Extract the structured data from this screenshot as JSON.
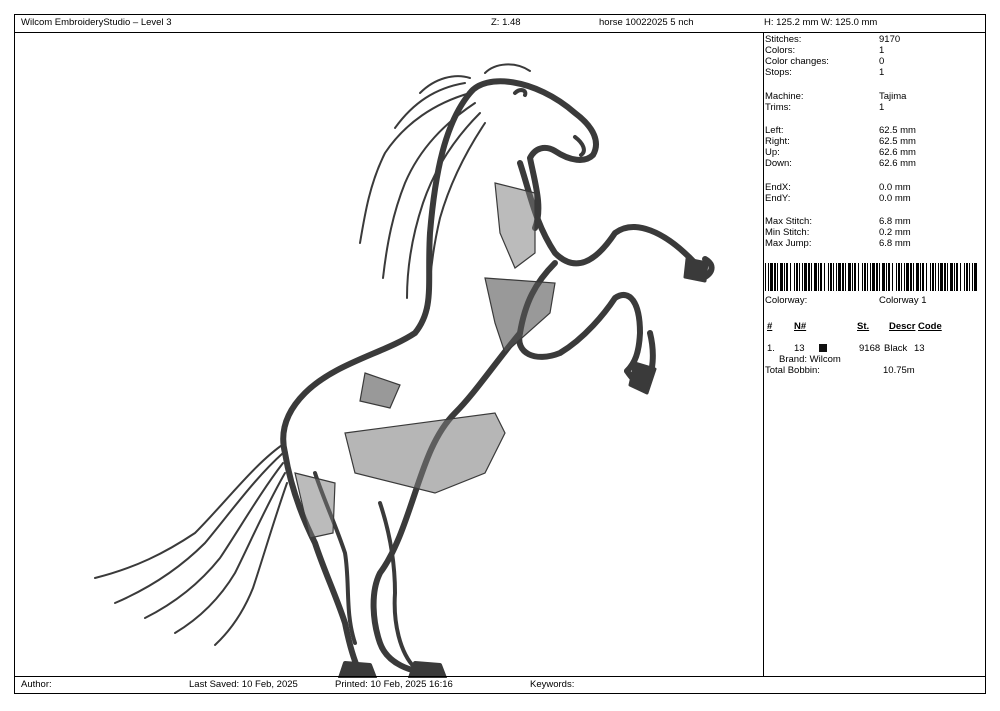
{
  "header": {
    "app_title": "Wilcom EmbroideryStudio – Level 3",
    "zoom": "Z: 1.48",
    "design_name": "horse 10022025 5 nch",
    "dimensions": "H: 125.2 mm   W: 125.0 mm"
  },
  "stats": {
    "stitches": {
      "label": "Stitches:",
      "value": "9170"
    },
    "colors": {
      "label": "Colors:",
      "value": "1"
    },
    "color_changes": {
      "label": "Color changes:",
      "value": "0"
    },
    "stops": {
      "label": "Stops:",
      "value": "1"
    },
    "machine": {
      "label": "Machine:",
      "value": "Tajima"
    },
    "trims": {
      "label": "Trims:",
      "value": "1"
    },
    "left": {
      "label": "Left:",
      "value": "62.5 mm"
    },
    "right": {
      "label": "Right:",
      "value": "62.5 mm"
    },
    "up": {
      "label": "Up:",
      "value": "62.6 mm"
    },
    "down": {
      "label": "Down:",
      "value": "62.6 mm"
    },
    "endx": {
      "label": "EndX:",
      "value": "0.0 mm"
    },
    "endy": {
      "label": "EndY:",
      "value": "0.0 mm"
    },
    "max_stitch": {
      "label": "Max Stitch:",
      "value": "6.8 mm"
    },
    "min_stitch": {
      "label": "Min Stitch:",
      "value": "0.2 mm"
    },
    "max_jump": {
      "label": "Max Jump:",
      "value": "6.8 mm"
    }
  },
  "colorway": {
    "label": "Colorway:",
    "value": "Colorway 1"
  },
  "color_table": {
    "headers": {
      "num": "#",
      "needle": "N#",
      "stitches": "St.",
      "descr": "Descr",
      "code": "Code"
    },
    "rows": [
      {
        "num": "1.",
        "needle": "13",
        "stitches": "9168",
        "descr": "Black",
        "code": "13",
        "brand": "Brand: Wilcom",
        "swatch_color": "#111111"
      }
    ]
  },
  "bobbin": {
    "label": "Total Bobbin:",
    "value": "10.75m"
  },
  "footer": {
    "author": "Author:",
    "last_saved": "Last Saved: 10 Feb, 2025",
    "printed": "Printed: 10 Feb, 2025 16:16",
    "keywords": "Keywords:"
  },
  "design_preview": {
    "subject": "rearing horse embroidery",
    "thread_color": "#3a3a3a"
  }
}
